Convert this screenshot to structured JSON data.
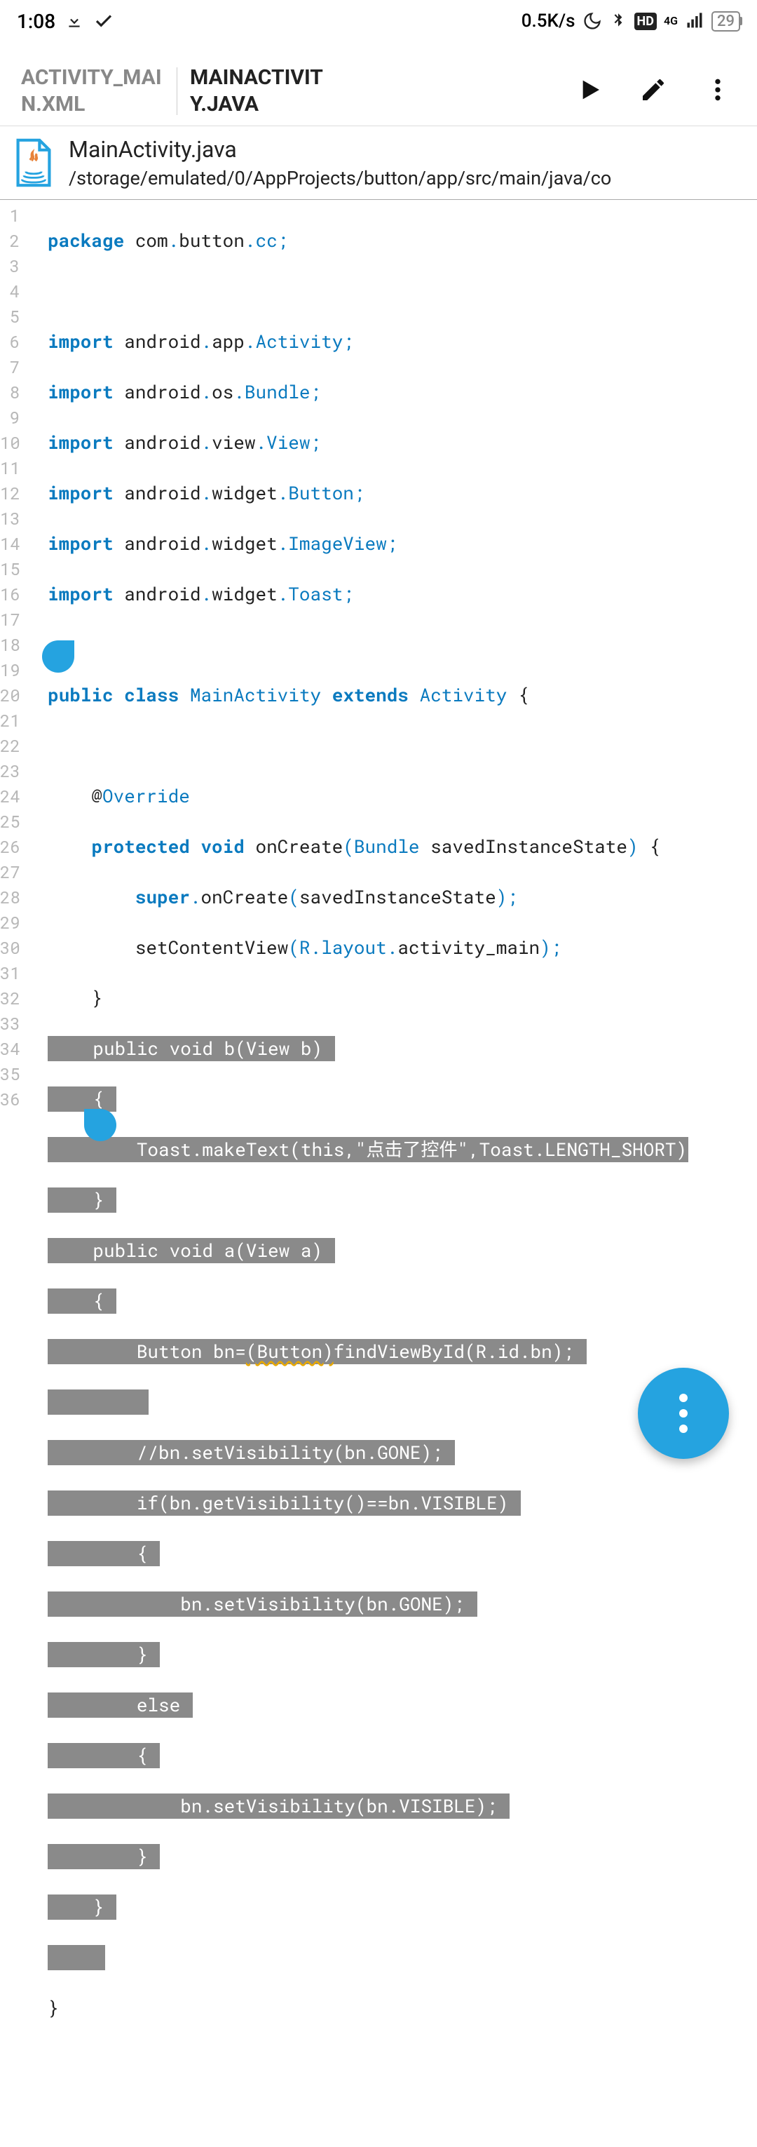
{
  "status": {
    "time": "1:08",
    "speed": "0.5K/s",
    "network": "4G",
    "battery": "29",
    "hd": "HD"
  },
  "tabs": {
    "left": "ACTIVITY_MAIN.XML",
    "right": "MAINACTIVITY.JAVA"
  },
  "file": {
    "name": "MainActivity.java",
    "path": "/storage/emulated/0/AppProjects/button/app/src/main/java/co"
  },
  "code": {
    "lines": {
      "l1_package": "package",
      "l1_pkg": " com",
      "l1_d1": ".",
      "l1_p2": "button",
      "l1_d2": ".",
      "l1_p3": "cc",
      "l1_s": ";",
      "l3_import": "import",
      "l3_a": " android",
      "l3_d1": ".",
      "l3_b": "app",
      "l3_d2": ".",
      "l3_c": "Activity",
      "l3_s": ";",
      "l4_import": "import",
      "l4_a": " android",
      "l4_d1": ".",
      "l4_b": "os",
      "l4_d2": ".",
      "l4_c": "Bundle",
      "l4_s": ";",
      "l5_import": "import",
      "l5_a": " android",
      "l5_d1": ".",
      "l5_b": "view",
      "l5_d2": ".",
      "l5_c": "View",
      "l5_s": ";",
      "l6_import": "import",
      "l6_a": " android",
      "l6_d1": ".",
      "l6_b": "widget",
      "l6_d2": ".",
      "l6_c": "Button",
      "l6_s": ";",
      "l7_import": "import",
      "l7_a": " android",
      "l7_d1": ".",
      "l7_b": "widget",
      "l7_d2": ".",
      "l7_c": "ImageView",
      "l7_s": ";",
      "l8_import": "import",
      "l8_a": " android",
      "l8_d1": ".",
      "l8_b": "widget",
      "l8_d2": ".",
      "l8_c": "Toast",
      "l8_s": ";",
      "l10_public": "public",
      "l10_class": " class",
      "l10_name": " MainActivity",
      "l10_extends": " extends",
      "l10_act": " Activity ",
      "l10_brace": "{",
      "l12_at": "    @",
      "l12_ov": "Override",
      "l13_prot": "    protected",
      "l13_void": " void",
      "l13_on": " onCreate",
      "l13_p1": "(",
      "l13_bun": "Bundle",
      "l13_arg": " savedInstanceState",
      "l13_p2": ")",
      "l13_sp": " ",
      "l13_brace": "{",
      "l14_super": "        super",
      "l14_d": ".",
      "l14_on": "onCreate",
      "l14_p1": "(",
      "l14_arg": "savedInstanceState",
      "l14_p2": ")",
      "l14_s": ";",
      "l15_a": "        setContentView",
      "l15_p1": "(",
      "l15_r": "R",
      "l15_d1": ".",
      "l15_lay": "layout",
      "l15_d2": ".",
      "l15_am": "activity_main",
      "l15_p2": ")",
      "l15_s": ";",
      "l16_brace": "    }",
      "l17": "    public void b(View b) ",
      "l18": "    { ",
      "l19": "        Toast.makeText(this,\"点击了控件\",Toast.LENGTH_SHORT)",
      "l20": "    } ",
      "l21": "    public void a(View a) ",
      "l22": "    { ",
      "l23a": "        Button bn=",
      "l23b": "(Button)",
      "l23c": "findViewById(R.id.bn); ",
      "l24": "         ",
      "l25": "        //bn.setVisibility(bn.GONE); ",
      "l26": "        if(bn.getVisibility()==bn.VISIBLE) ",
      "l27": "        { ",
      "l28": "            bn.setVisibility(bn.GONE); ",
      "l29": "        } ",
      "l30": "        else ",
      "l31": "        { ",
      "l32": "            bn.setVisibility(bn.VISIBLE); ",
      "l33": "        } ",
      "l34": "    } ",
      "l35": "     ",
      "l36_brace": "}"
    }
  }
}
